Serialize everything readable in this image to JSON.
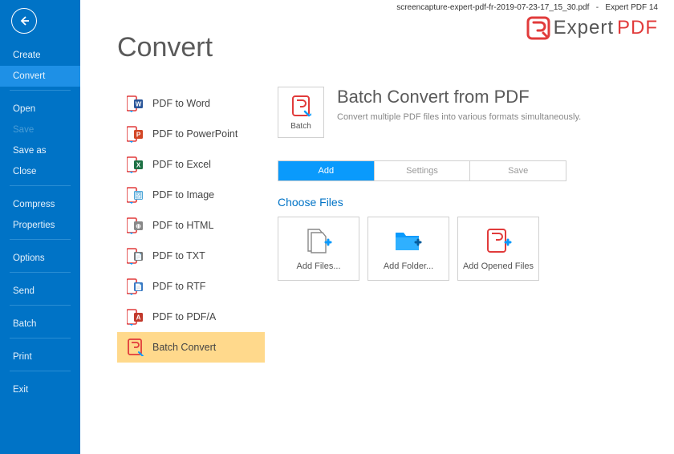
{
  "topbar": {
    "filename": "screencapture-expert-pdf-fr-2019-07-23-17_15_30.pdf",
    "sep": "-",
    "app": "Expert PDF 14"
  },
  "logo": {
    "part1": "Expert",
    "part2": "PDF"
  },
  "sidebar": {
    "items": [
      {
        "label": "Create",
        "sel": false,
        "group": 0
      },
      {
        "label": "Convert",
        "sel": true,
        "group": 0
      },
      {
        "label": "Open",
        "sel": false,
        "group": 1
      },
      {
        "label": "Save",
        "sel": false,
        "group": 1,
        "disabled": true
      },
      {
        "label": "Save as",
        "sel": false,
        "group": 1
      },
      {
        "label": "Close",
        "sel": false,
        "group": 1
      },
      {
        "label": "Compress",
        "sel": false,
        "group": 2
      },
      {
        "label": "Properties",
        "sel": false,
        "group": 2
      },
      {
        "label": "Options",
        "sel": false,
        "group": 3
      },
      {
        "label": "Send",
        "sel": false,
        "group": 4
      },
      {
        "label": "Batch",
        "sel": false,
        "group": 5
      },
      {
        "label": "Print",
        "sel": false,
        "group": 6
      },
      {
        "label": "Exit",
        "sel": false,
        "group": 7
      }
    ]
  },
  "page": {
    "title": "Convert",
    "convert_options": [
      {
        "label": "PDF to Word",
        "icon": "word",
        "sel": false
      },
      {
        "label": "PDF to PowerPoint",
        "icon": "ppt",
        "sel": false
      },
      {
        "label": "PDF to Excel",
        "icon": "excel",
        "sel": false
      },
      {
        "label": "PDF to Image",
        "icon": "image",
        "sel": false
      },
      {
        "label": "PDF to HTML",
        "icon": "html",
        "sel": false
      },
      {
        "label": "PDF to TXT",
        "icon": "txt",
        "sel": false
      },
      {
        "label": "PDF to RTF",
        "icon": "rtf",
        "sel": false
      },
      {
        "label": "PDF to PDF/A",
        "icon": "pdfa",
        "sel": false
      },
      {
        "label": "Batch Convert",
        "icon": "batch",
        "sel": true
      }
    ],
    "panel": {
      "batch_label": "Batch",
      "title": "Batch Convert from PDF",
      "subtitle": "Convert multiple PDF files into various formats simultaneously.",
      "tabs": [
        {
          "label": "Add",
          "sel": true
        },
        {
          "label": "Settings",
          "sel": false
        },
        {
          "label": "Save",
          "sel": false
        }
      ],
      "section": "Choose Files",
      "cards": [
        {
          "label": "Add Files...",
          "icon": "add-files"
        },
        {
          "label": "Add Folder...",
          "icon": "add-folder"
        },
        {
          "label": "Add Opened Files",
          "icon": "add-opened"
        }
      ]
    }
  }
}
